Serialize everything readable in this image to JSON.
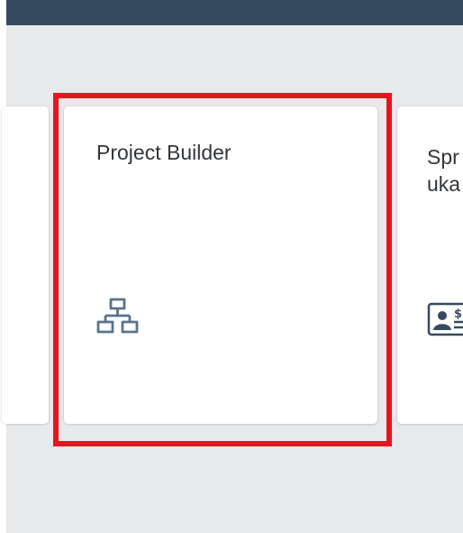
{
  "shell": {
    "bar_color": "#354a5f"
  },
  "tiles": {
    "previous": {
      "title": ""
    },
    "main": {
      "title": "Project Builder",
      "icon": "hierarchy-icon"
    },
    "next": {
      "title": "Spr\nuka",
      "icon": "id-card-dollar-icon"
    }
  },
  "highlight": {
    "color": "#e8141f"
  }
}
